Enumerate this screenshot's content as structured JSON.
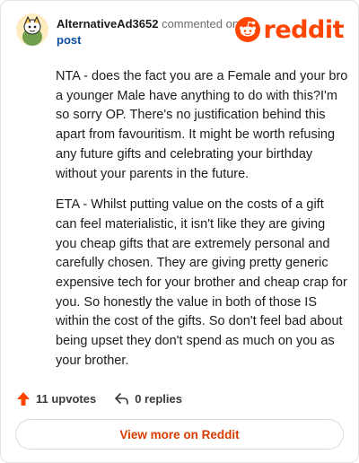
{
  "header": {
    "username": "AlternativeAd3652",
    "action_text": "commented on",
    "post_link": "post",
    "brand": "reddit"
  },
  "comment": {
    "paragraphs": [
      "NTA - does the fact you are a Female and your bro a younger Male have anything to do with this?I'm so sorry OP. There's no justification behind this apart from favouritism. It might be worth refusing any future gifts and celebrating your birthday without your parents in the future.",
      "ETA - Whilst putting value on the costs of a gift can feel materialistic, it isn't like they are giving you cheap gifts that are extremely personal and carefully chosen. They are giving pretty generic expensive tech for your brother and cheap crap for you. So honestly the value in both of those IS within the cost of the gifts. So don't feel bad about being upset they don't spend as much on you as your brother."
    ]
  },
  "actions": {
    "upvotes": "11 upvotes",
    "replies": "0 replies"
  },
  "footer": {
    "view_more": "View more on Reddit"
  },
  "colors": {
    "brand": "#ff4500",
    "link": "#0a4ea3",
    "view_more": "#d93a00"
  },
  "icons": [
    "avatar-icon",
    "reddit-snoo-icon",
    "upvote-arrow-icon",
    "reply-arrow-icon"
  ]
}
